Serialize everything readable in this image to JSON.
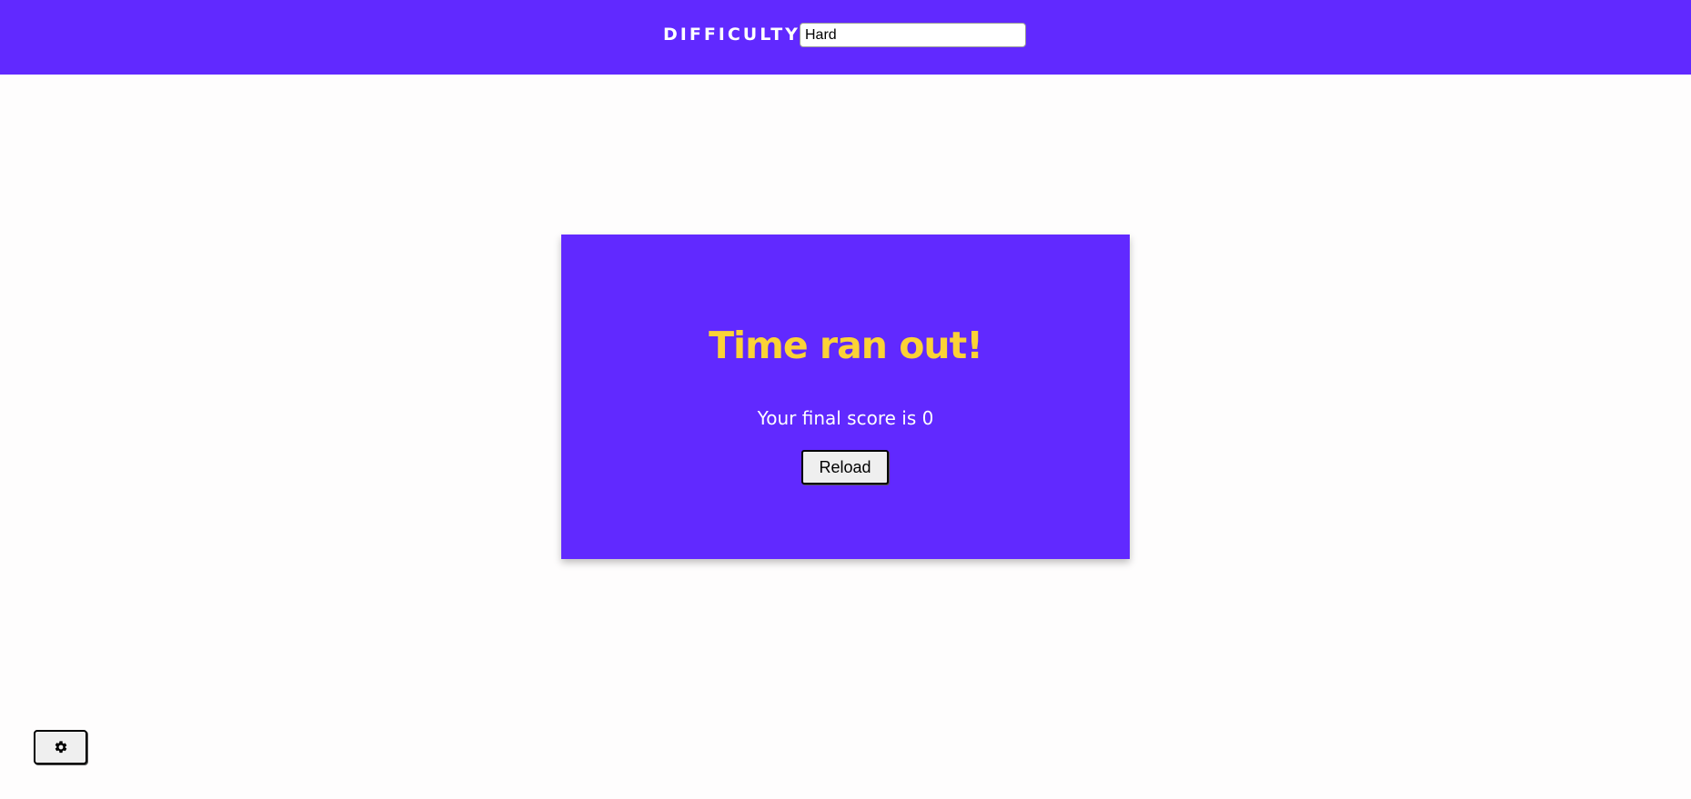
{
  "header": {
    "difficulty_label": "DIFFICULTY:",
    "difficulty_value": "Hard"
  },
  "modal": {
    "title": "Time ran out!",
    "score_text": "Your final score is 0",
    "reload_label": "Reload"
  },
  "settings": {
    "icon": "gear-icon"
  },
  "colors": {
    "brand": "#6129ff",
    "title_accent": "#fbd236",
    "background": "#fefdfd"
  }
}
